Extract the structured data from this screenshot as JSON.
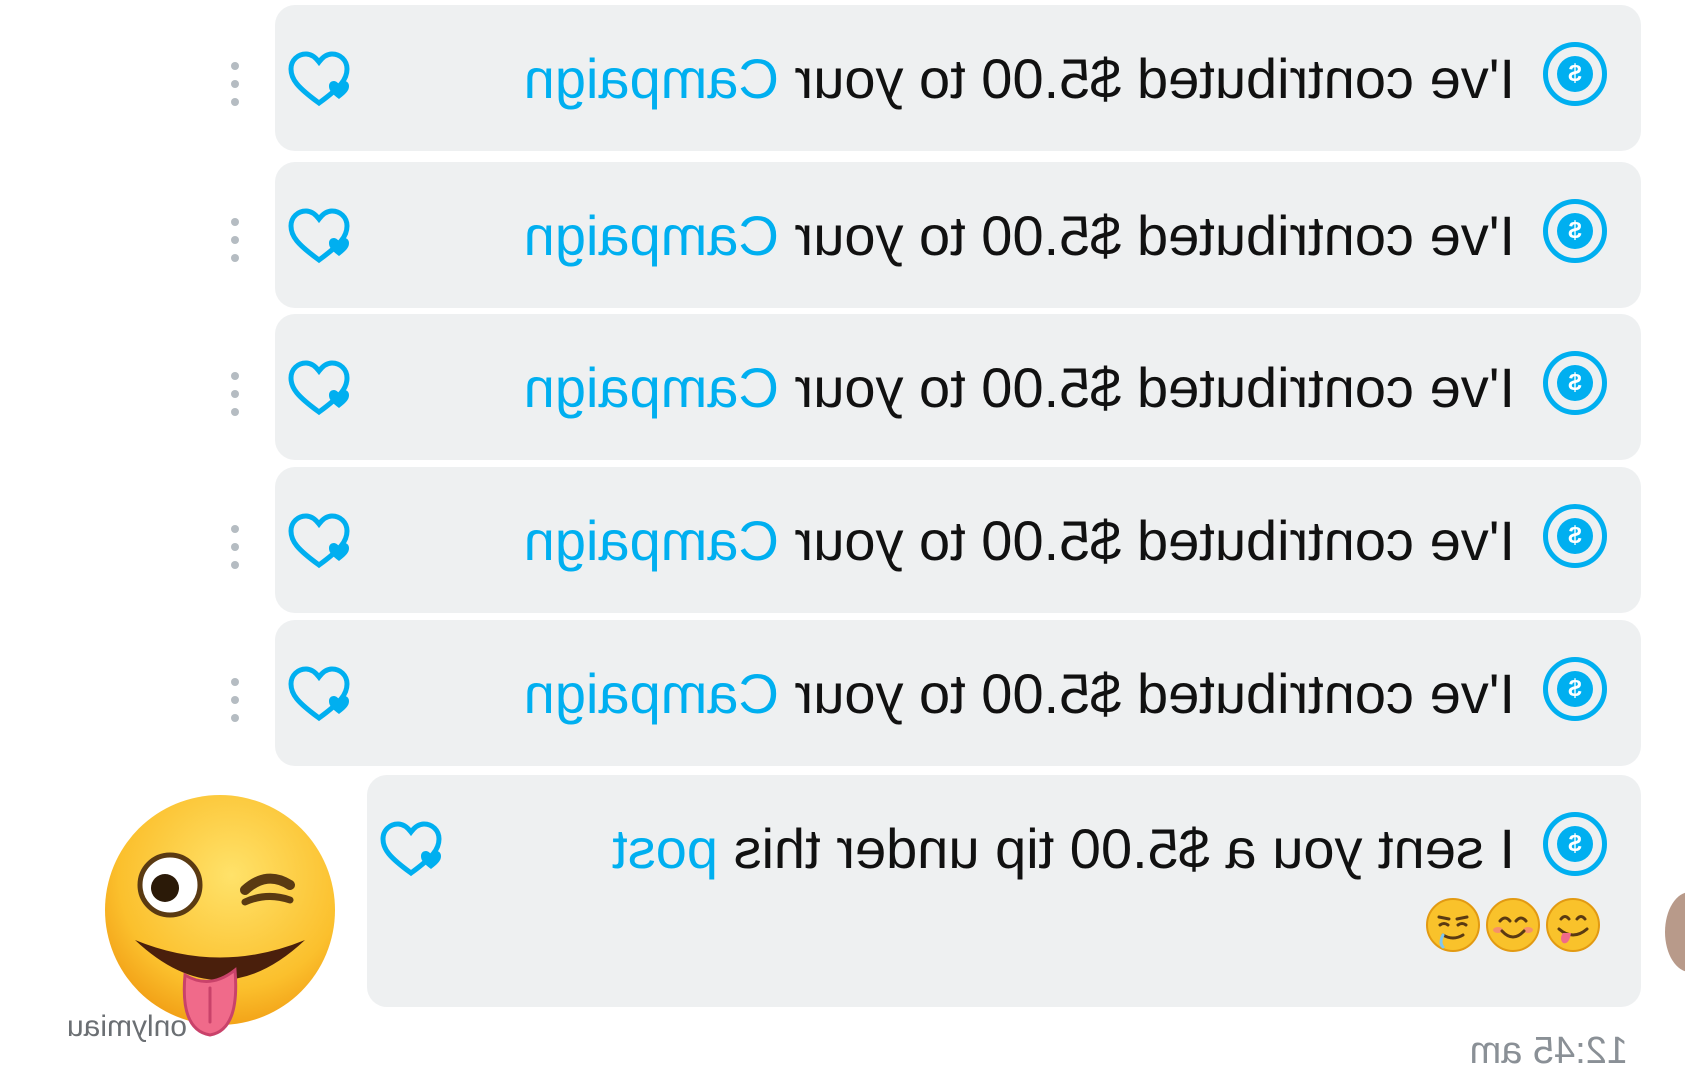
{
  "messages": [
    {
      "text": "I've contributed $5.00 to your ",
      "link": "Campaign"
    },
    {
      "text": "I've contributed $5.00 to your ",
      "link": "Campaign"
    },
    {
      "text": "I've contributed $5.00 to your ",
      "link": "Campaign"
    },
    {
      "text": "I've contributed $5.00 to your ",
      "link": "Campaign"
    },
    {
      "text": "I've contributed $5.00 to your ",
      "link": "Campaign"
    }
  ],
  "tip_message": {
    "text": "I sent you a $5.00 tip under this ",
    "link": "post"
  },
  "dollar_glyph": "$",
  "timestamp": "12:45 am",
  "watermark": "onlymiau",
  "icons": {
    "dollar": "dollar-circle-icon",
    "like": "heart-like-icon",
    "more": "more-vertical-icon",
    "emoji_big": "winking-face-with-tongue",
    "emojis_small": [
      "face-savoring-food",
      "smiling-face-with-smiling-eyes",
      "relieved-face-with-tongue"
    ]
  },
  "colors": {
    "accent": "#00aff0",
    "bubble": "#eef0f1",
    "text": "#111111",
    "meta": "#8a9096"
  }
}
